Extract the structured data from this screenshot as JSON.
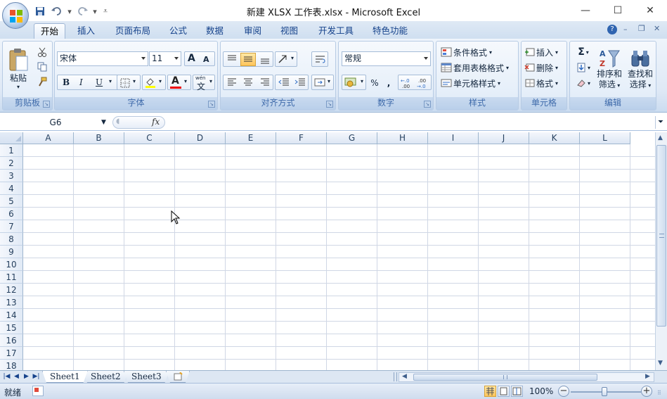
{
  "window": {
    "title": "新建 XLSX 工作表.xlsx - Microsoft Excel",
    "minimize_icon": "minimize-icon",
    "maximize_icon": "maximize-icon",
    "close_icon": "close-icon"
  },
  "qat": {
    "save_icon": "save-icon",
    "undo_icon": "undo-icon",
    "redo_icon": "redo-icon",
    "customize_icon": "customize-icon"
  },
  "tabs": [
    "开始",
    "插入",
    "页面布局",
    "公式",
    "数据",
    "审阅",
    "视图",
    "开发工具",
    "特色功能"
  ],
  "active_tab": "开始",
  "ribbon": {
    "clipboard": {
      "label": "剪贴板",
      "paste": "粘贴"
    },
    "font": {
      "label": "字体",
      "font_name": "宋体",
      "font_size": "11",
      "bold": "B",
      "italic": "I",
      "underline": "U",
      "wen": "wén",
      "wen_char": "文",
      "grow": "A",
      "shrink": "A"
    },
    "alignment": {
      "label": "对齐方式"
    },
    "number": {
      "label": "数字",
      "format": "常规",
      "percent": "%",
      "comma": ",",
      "inc_decimal": "+.0 .00",
      "dec_decimal": ".00 →.0"
    },
    "styles": {
      "label": "样式",
      "conditional": "条件格式",
      "table_format": "套用表格格式",
      "cell_styles": "单元格样式"
    },
    "cells": {
      "label": "单元格",
      "insert": "插入",
      "delete": "删除",
      "format": "格式"
    },
    "editing": {
      "label": "编辑",
      "sum": "Σ",
      "sort_filter_1": "排序和",
      "sort_filter_2": "筛选",
      "find_select_1": "查找和",
      "find_select_2": "选择"
    }
  },
  "formula_bar": {
    "name_box": "G6",
    "fx": "fx",
    "value": ""
  },
  "columns": [
    "A",
    "B",
    "C",
    "D",
    "E",
    "F",
    "G",
    "H",
    "I",
    "J",
    "K",
    "L"
  ],
  "rows": [
    "1",
    "2",
    "3",
    "4",
    "5",
    "6",
    "7",
    "8",
    "9",
    "10",
    "11",
    "12",
    "13",
    "14",
    "15",
    "16",
    "17",
    "18"
  ],
  "sheets": [
    "Sheet1",
    "Sheet2",
    "Sheet3"
  ],
  "active_sheet": "Sheet1",
  "status": {
    "ready": "就绪",
    "zoom": "100%"
  },
  "colors": {
    "ribbon_bg": "#dfe9f6",
    "tab_text": "#15428b",
    "grid_line": "#d0d7e5",
    "group_label": "#3e6aaa"
  }
}
